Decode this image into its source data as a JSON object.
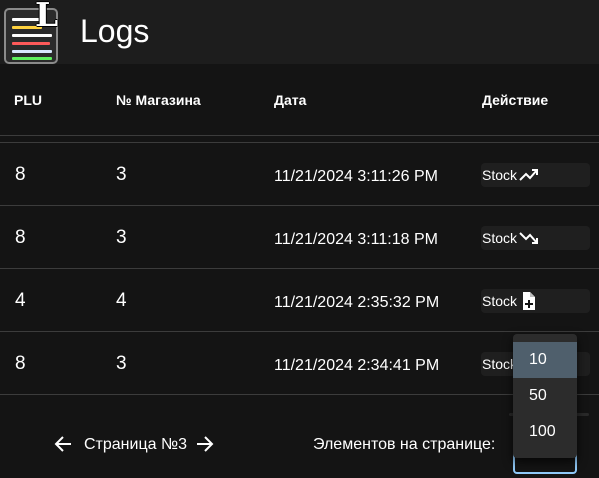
{
  "app": {
    "title": "Logs",
    "logo_letter": "L"
  },
  "colors": {
    "logo_lines": [
      "#ffffff",
      "#ffd23f",
      "#ff5a5a",
      "#d8e8ff",
      "#5ef05e"
    ],
    "select_outline": "#90caf9",
    "selected_option_bg": "#4f5f6c"
  },
  "table": {
    "headers": {
      "plu": "PLU",
      "store": "№ Магазина",
      "date": "Дата",
      "action": "Действие"
    },
    "rows": [
      {
        "plu": "8",
        "store": "3",
        "date": "11/21/2024 3:11:26 PM",
        "action_label": "Stock",
        "action_icon": "trending-up-icon"
      },
      {
        "plu": "8",
        "store": "3",
        "date": "11/21/2024 3:11:18 PM",
        "action_label": "Stock",
        "action_icon": "trending-down-icon"
      },
      {
        "plu": "4",
        "store": "4",
        "date": "11/21/2024 2:35:32 PM",
        "action_label": "Stock",
        "action_icon": "file-add-icon"
      },
      {
        "plu": "8",
        "store": "3",
        "date": "11/21/2024 2:34:41 PM",
        "action_label": "Stock",
        "action_icon": ""
      }
    ]
  },
  "pagination": {
    "prev_icon": "arrow-left-icon",
    "page_label": "Страница №3",
    "next_icon": "arrow-right-icon",
    "per_page_label": "Элементов на странице:",
    "per_page_value": "10",
    "options": [
      "10",
      "50",
      "100"
    ]
  }
}
